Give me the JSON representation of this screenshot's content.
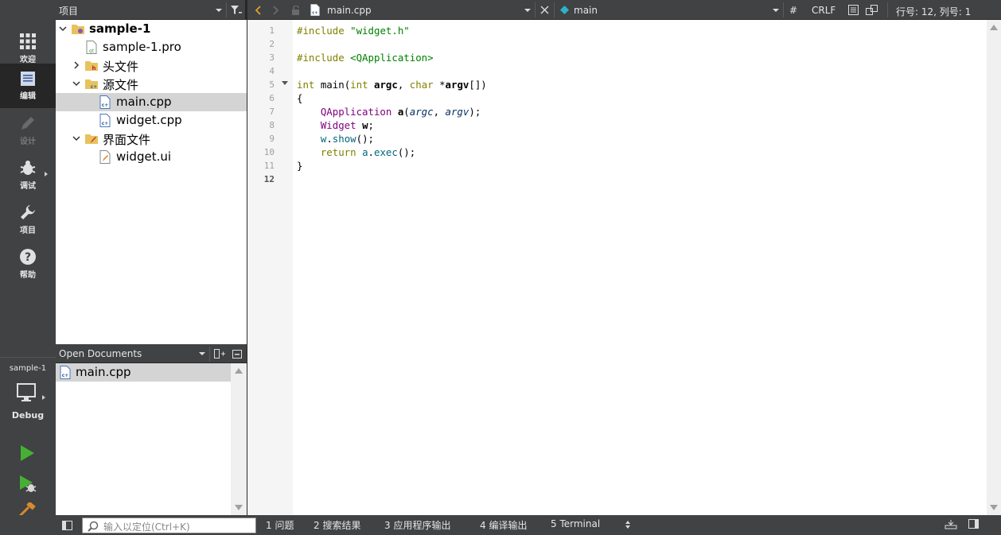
{
  "modes": [
    {
      "label": "欢迎",
      "icon": "grid-icon"
    },
    {
      "label": "编辑",
      "icon": "edit-document-icon"
    },
    {
      "label": "设计",
      "icon": "pencil-icon"
    },
    {
      "label": "调试",
      "icon": "bug-icon"
    },
    {
      "label": "项目",
      "icon": "wrench-icon"
    },
    {
      "label": "帮助",
      "icon": "help-icon"
    }
  ],
  "kit": {
    "project": "sample-1",
    "build": "Debug"
  },
  "projects_pane": {
    "title": "项目"
  },
  "tree": [
    {
      "label": "sample-1",
      "icon": "project-folder-icon",
      "chevron": "down"
    },
    {
      "label": "sample-1.pro",
      "icon": "pro-file-icon",
      "chevron": "none"
    },
    {
      "label": "头文件",
      "icon": "header-folder-icon",
      "chevron": "right"
    },
    {
      "label": "源文件",
      "icon": "source-folder-icon",
      "chevron": "down"
    },
    {
      "label": "main.cpp",
      "icon": "cpp-file-icon",
      "chevron": "none"
    },
    {
      "label": "widget.cpp",
      "icon": "cpp-file-icon",
      "chevron": "none"
    },
    {
      "label": "界面文件",
      "icon": "form-folder-icon",
      "chevron": "down"
    },
    {
      "label": "widget.ui",
      "icon": "ui-file-icon",
      "chevron": "none"
    }
  ],
  "open_docs": {
    "title": "Open Documents",
    "items": [
      "main.cpp"
    ]
  },
  "editor_toolbar": {
    "file": "main.cpp",
    "symbol": "main",
    "hash": "#",
    "line_ending": "CRLF",
    "position": "行号: 12, 列号: 1"
  },
  "code_lines": [
    "1",
    "2",
    "3",
    "4",
    "5",
    "6",
    "7",
    "8",
    "9",
    "10",
    "11",
    "12"
  ],
  "code": {
    "l1a": "#include ",
    "l1b": "\"widget.h\"",
    "l3a": "#include ",
    "l3b": "<QApplication>",
    "l5a": "int",
    "l5b": " main(",
    "l5c": "int",
    "l5d": " argc",
    "l5e": ", ",
    "l5f": "char",
    "l5g": " *",
    "l5h": "argv",
    "l5i": "[])",
    "l6": "{",
    "l7a": "    QApplication",
    "l7b": " a",
    "l7c": "(",
    "l7d": "argc",
    "l7e": ", ",
    "l7f": "argv",
    "l7g": ");",
    "l8a": "    Widget",
    "l8b": " w",
    "l8c": ";",
    "l9a": "    w",
    "l9b": ".",
    "l9c": "show",
    "l9d": "();",
    "l10a": "    return",
    "l10b": " a",
    "l10c": ".",
    "l10d": "exec",
    "l10e": "();",
    "l11": "}"
  },
  "status": {
    "locator_placeholder": "输入以定位(Ctrl+K)",
    "panes": [
      "1  问题",
      "2  搜索结果",
      "3  应用程序输出",
      "4  编译输出",
      "5  Terminal"
    ]
  }
}
